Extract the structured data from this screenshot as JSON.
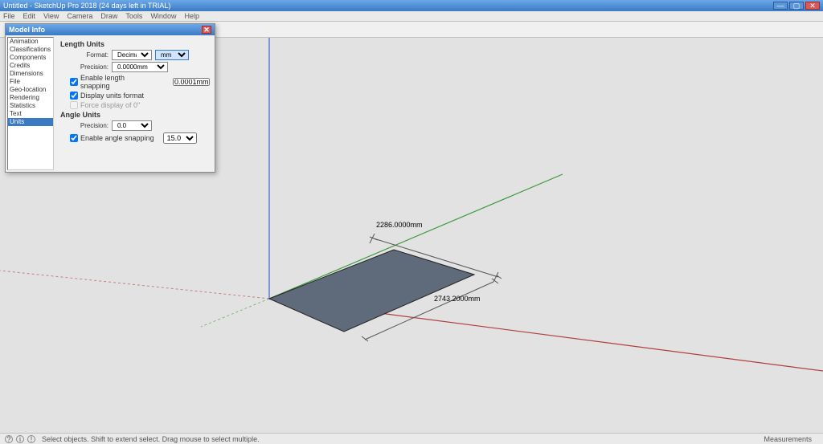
{
  "title": "Untitled - SketchUp Pro 2018 (24 days left in TRIAL)",
  "menu": [
    "File",
    "Edit",
    "View",
    "Camera",
    "Draw",
    "Tools",
    "Window",
    "Help"
  ],
  "status": {
    "hint": "Select objects. Shift to extend select. Drag mouse to select multiple.",
    "measure_label": "Measurements"
  },
  "dialog": {
    "title": "Model Info",
    "categories": [
      "Animation",
      "Classifications",
      "Components",
      "Credits",
      "Dimensions",
      "File",
      "Geo-location",
      "Rendering",
      "Statistics",
      "Text",
      "Units"
    ],
    "selected_index": 10,
    "section_length": "Length Units",
    "section_angle": "Angle Units",
    "format_label": "Format:",
    "format_value": "Decimal",
    "format_unit": "mm",
    "precision_label": "Precision:",
    "precision_length": "0.0000mm",
    "cb_snap": "Enable length snapping",
    "snap_value": "0.0001mm",
    "cb_display": "Display units format",
    "cb_force0": "Force display of 0\"",
    "precision_angle": "0.0",
    "cb_angle_snap": "Enable angle snapping",
    "angle_snap_value": "15.0"
  },
  "dims": {
    "d1": "2286.0000mm",
    "d2": "2743.2000mm"
  },
  "icons": {
    "min": "—",
    "max": "▢",
    "close": "✕",
    "i1": "?",
    "i2": "i",
    "i3": "!"
  }
}
